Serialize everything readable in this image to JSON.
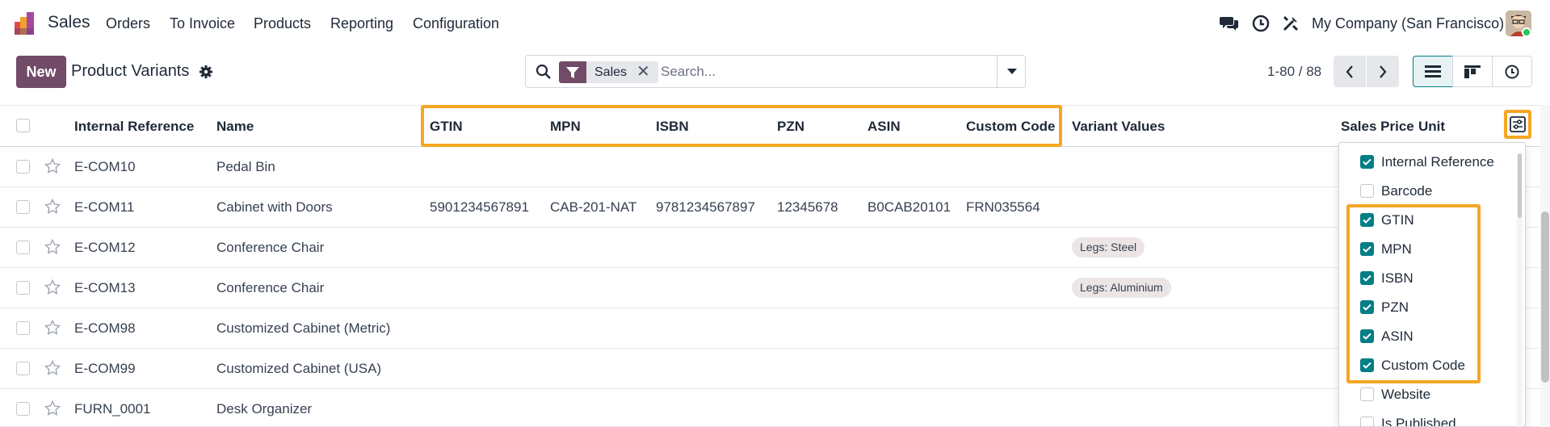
{
  "app": {
    "name": "Sales"
  },
  "menu": [
    "Orders",
    "To Invoice",
    "Products",
    "Reporting",
    "Configuration"
  ],
  "company": "My Company (San Francisco)",
  "control": {
    "new_label": "New",
    "title": "Product Variants",
    "facet_label": "Sales",
    "facet_remove": "✕",
    "search_placeholder": "Search...",
    "pager": "1-80 / 88"
  },
  "columns": {
    "internal_reference": "Internal Reference",
    "name": "Name",
    "gtin": "GTIN",
    "mpn": "MPN",
    "isbn": "ISBN",
    "pzn": "PZN",
    "asin": "ASIN",
    "custom_code": "Custom Code",
    "variant_values": "Variant Values",
    "sales_price": "Sales Price",
    "unit": "Unit"
  },
  "rows": [
    {
      "ref": "E-COM10",
      "name": "Pedal Bin",
      "gtin": "",
      "mpn": "",
      "isbn": "",
      "pzn": "",
      "asin": "",
      "custom": "",
      "variant": ""
    },
    {
      "ref": "E-COM11",
      "name": "Cabinet with Doors",
      "gtin": "5901234567891",
      "mpn": "CAB-201-NAT",
      "isbn": "9781234567897",
      "pzn": "12345678",
      "asin": "B0CAB20101",
      "custom": "FRN035564",
      "variant": ""
    },
    {
      "ref": "E-COM12",
      "name": "Conference Chair",
      "gtin": "",
      "mpn": "",
      "isbn": "",
      "pzn": "",
      "asin": "",
      "custom": "",
      "variant": "Legs: Steel"
    },
    {
      "ref": "E-COM13",
      "name": "Conference Chair",
      "gtin": "",
      "mpn": "",
      "isbn": "",
      "pzn": "",
      "asin": "",
      "custom": "",
      "variant": "Legs: Aluminium"
    },
    {
      "ref": "E-COM98",
      "name": "Customized Cabinet (Metric)",
      "gtin": "",
      "mpn": "",
      "isbn": "",
      "pzn": "",
      "asin": "",
      "custom": "",
      "variant": ""
    },
    {
      "ref": "E-COM99",
      "name": "Customized Cabinet (USA)",
      "gtin": "",
      "mpn": "",
      "isbn": "",
      "pzn": "",
      "asin": "",
      "custom": "",
      "variant": ""
    },
    {
      "ref": "FURN_0001",
      "name": "Desk Organizer",
      "gtin": "",
      "mpn": "",
      "isbn": "",
      "pzn": "",
      "asin": "",
      "custom": "",
      "variant": ""
    }
  ],
  "optional_columns": [
    {
      "label": "Internal Reference",
      "checked": true
    },
    {
      "label": "Barcode",
      "checked": false
    },
    {
      "label": "GTIN",
      "checked": true
    },
    {
      "label": "MPN",
      "checked": true
    },
    {
      "label": "ISBN",
      "checked": true
    },
    {
      "label": "PZN",
      "checked": true
    },
    {
      "label": "ASIN",
      "checked": true
    },
    {
      "label": "Custom Code",
      "checked": true
    },
    {
      "label": "Website",
      "checked": false
    },
    {
      "label": "Is Published",
      "checked": false
    }
  ],
  "colors": {
    "brand": "#714b67",
    "accent": "#017e84",
    "highlight": "#f5a623"
  }
}
